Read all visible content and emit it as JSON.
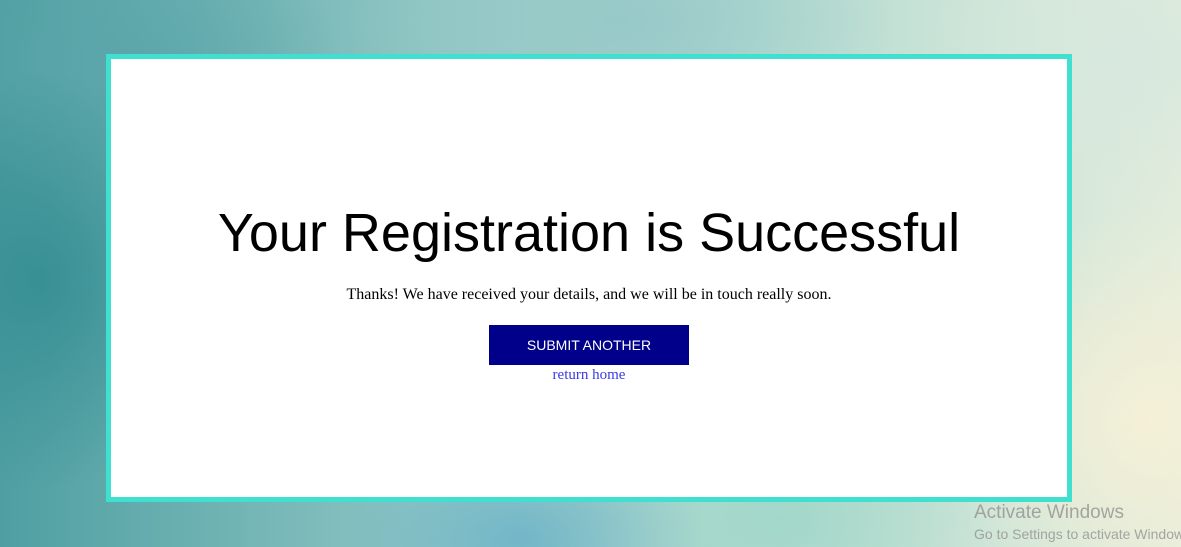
{
  "colors": {
    "card_border": "#40e0d0",
    "button_background": "#00008b",
    "button_text": "#ffffff",
    "link": "#3b3be6"
  },
  "registration": {
    "title": "Your Registration is Successful",
    "message": "Thanks! We have received your details, and we will be in touch really soon.",
    "submit_another_label": "SUBMIT ANOTHER",
    "return_home_label": "return home"
  },
  "os_watermark": {
    "title": "Activate Windows",
    "subtitle": "Go to Settings to activate Windows."
  }
}
